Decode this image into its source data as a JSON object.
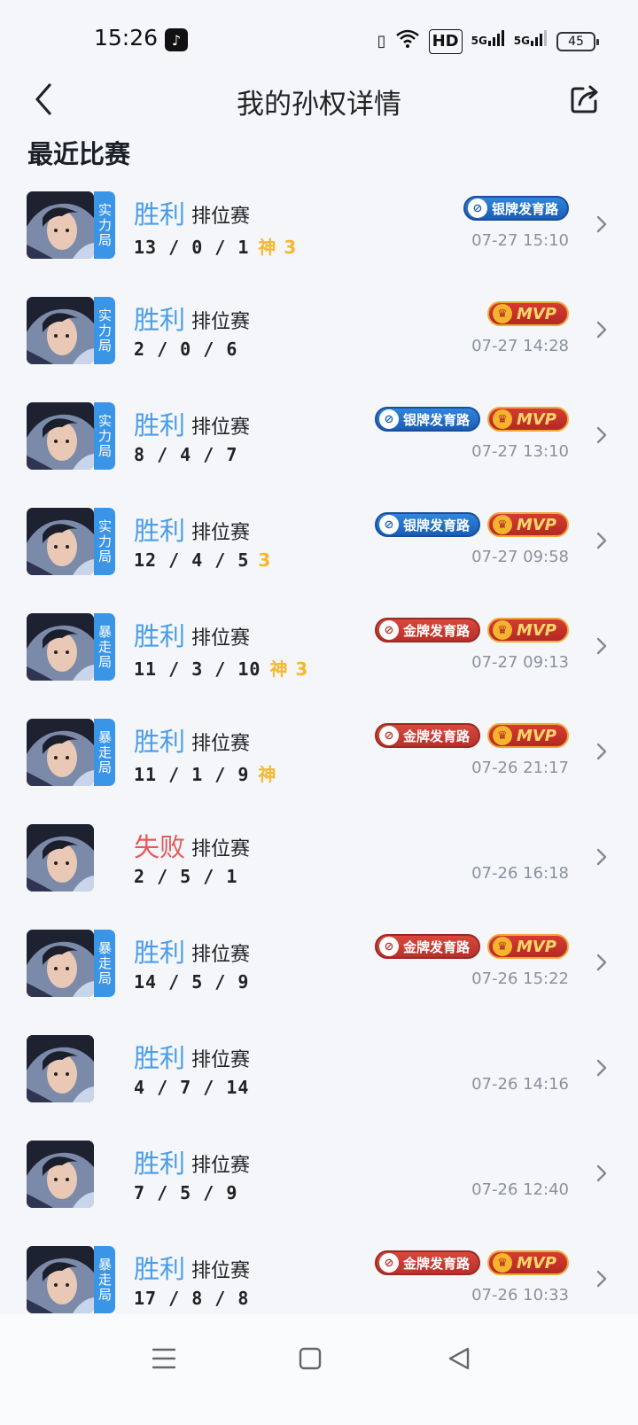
{
  "status_bar": {
    "time": "15:26",
    "battery": "45",
    "hd": "HD",
    "net1": "5G",
    "net2": "5G"
  },
  "header": {
    "title": "我的孙权详情",
    "back_icon": "chevron-left-icon",
    "share_icon": "share-icon"
  },
  "section": {
    "title": "最近比赛"
  },
  "matches": [
    {
      "result": "胜利",
      "type": "排位赛",
      "kda": "13 / 0 / 1",
      "feat": "神 3",
      "mode": "实力局",
      "badges": [
        "银牌发育路"
      ],
      "time": "07-27 15:10"
    },
    {
      "result": "胜利",
      "type": "排位赛",
      "kda": "2 / 0 / 6",
      "feat": "",
      "mode": "实力局",
      "badges": [
        "MVP"
      ],
      "time": "07-27 14:28"
    },
    {
      "result": "胜利",
      "type": "排位赛",
      "kda": "8 / 4 / 7",
      "feat": "",
      "mode": "实力局",
      "badges": [
        "银牌发育路",
        "MVP"
      ],
      "time": "07-27 13:10"
    },
    {
      "result": "胜利",
      "type": "排位赛",
      "kda": "12 / 4 / 5",
      "feat": "3",
      "mode": "实力局",
      "badges": [
        "银牌发育路",
        "MVP"
      ],
      "time": "07-27 09:58"
    },
    {
      "result": "胜利",
      "type": "排位赛",
      "kda": "11 / 3 / 10",
      "feat": "神 3",
      "mode": "暴走局",
      "badges": [
        "金牌发育路",
        "MVP"
      ],
      "time": "07-27 09:13"
    },
    {
      "result": "胜利",
      "type": "排位赛",
      "kda": "11 / 1 / 9",
      "feat": "神",
      "mode": "暴走局",
      "badges": [
        "金牌发育路",
        "MVP"
      ],
      "time": "07-26 21:17"
    },
    {
      "result": "失败",
      "type": "排位赛",
      "kda": "2 / 5 / 1",
      "feat": "",
      "mode": "",
      "badges": [],
      "time": "07-26 16:18"
    },
    {
      "result": "胜利",
      "type": "排位赛",
      "kda": "14 / 5 / 9",
      "feat": "",
      "mode": "暴走局",
      "badges": [
        "金牌发育路",
        "MVP"
      ],
      "time": "07-26 15:22"
    },
    {
      "result": "胜利",
      "type": "排位赛",
      "kda": "4 / 7 / 14",
      "feat": "",
      "mode": "",
      "badges": [],
      "time": "07-26 14:16"
    },
    {
      "result": "胜利",
      "type": "排位赛",
      "kda": "7 / 5 / 9",
      "feat": "",
      "mode": "",
      "badges": [],
      "time": "07-26 12:40"
    },
    {
      "result": "胜利",
      "type": "排位赛",
      "kda": "17 / 8 / 8",
      "feat": "",
      "mode": "暴走局",
      "badges": [
        "金牌发育路",
        "MVP"
      ],
      "time": "07-26 10:33"
    }
  ],
  "colors": {
    "win": "#4a9de8",
    "lose": "#e35a5a",
    "feat": "#f5b82e",
    "mode_tag": "#3b95e6"
  },
  "nav": {
    "menu_icon": "menu-icon",
    "home_icon": "home-icon",
    "back_icon": "back-triangle-icon"
  }
}
